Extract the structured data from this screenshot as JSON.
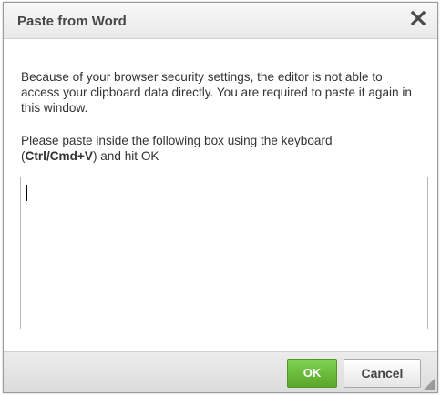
{
  "dialog": {
    "title": "Paste from Word",
    "close_icon": "close-icon",
    "instructions_1": "Because of your browser security settings, the editor is not able to access your clipboard data directly. You are required to paste it again in this window.",
    "instructions_2_prefix": "Please paste inside the following box using the keyboard",
    "instructions_2_shortcut": "Ctrl/Cmd+V",
    "instructions_2_suffix": "and hit OK",
    "paste_box_value": ""
  },
  "footer": {
    "ok_label": "OK",
    "cancel_label": "Cancel",
    "resize_icon": "resize-grip-icon"
  },
  "colors": {
    "ok_button": "#5ba629",
    "title_text": "#474747",
    "body_text": "#333333"
  }
}
